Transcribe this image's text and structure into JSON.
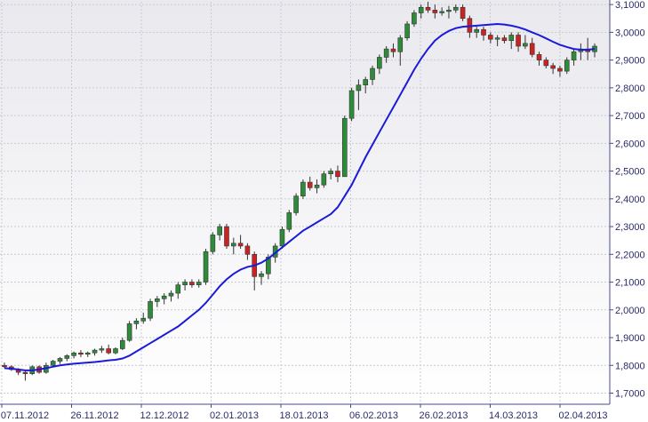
{
  "chart_data": {
    "type": "candlestick",
    "x_tick_labels": [
      "07.11.2012",
      "26.11.2012",
      "12.12.2012",
      "02.01.2013",
      "18.01.2013",
      "06.02.2013",
      "26.02.2013",
      "14.03.2013",
      "02.04.2013"
    ],
    "y_ticks": [
      1.7,
      1.8,
      1.9,
      2.0,
      2.1,
      2.2,
      2.3,
      2.4,
      2.5,
      2.6,
      2.7,
      2.8,
      2.9,
      3.0,
      3.1
    ],
    "y_tick_labels": [
      "1,7000",
      "1,8000",
      "1,9000",
      "2,0000",
      "2,1000",
      "2,2000",
      "2,3000",
      "2,4000",
      "2,5000",
      "2,6000",
      "2,7000",
      "2,8000",
      "2,9000",
      "3,0000",
      "3,1000"
    ],
    "ylim": [
      1.66,
      3.11
    ],
    "grid": true,
    "up_color": "#2e8b3a",
    "down_color": "#cc2222",
    "ma_color": "#1a1adb",
    "candles": [
      [
        1.8,
        1.81,
        1.79,
        1.795
      ],
      [
        1.795,
        1.8,
        1.78,
        1.785
      ],
      [
        1.785,
        1.79,
        1.765,
        1.775
      ],
      [
        1.775,
        1.78,
        1.745,
        1.77
      ],
      [
        1.77,
        1.8,
        1.765,
        1.795
      ],
      [
        1.795,
        1.8,
        1.77,
        1.775
      ],
      [
        1.775,
        1.81,
        1.77,
        1.8
      ],
      [
        1.8,
        1.82,
        1.795,
        1.815
      ],
      [
        1.815,
        1.83,
        1.805,
        1.825
      ],
      [
        1.825,
        1.84,
        1.815,
        1.835
      ],
      [
        1.835,
        1.85,
        1.825,
        1.845
      ],
      [
        1.845,
        1.855,
        1.83,
        1.84
      ],
      [
        1.84,
        1.85,
        1.83,
        1.845
      ],
      [
        1.845,
        1.86,
        1.835,
        1.855
      ],
      [
        1.855,
        1.87,
        1.845,
        1.86
      ],
      [
        1.86,
        1.875,
        1.84,
        1.845
      ],
      [
        1.845,
        1.865,
        1.84,
        1.86
      ],
      [
        1.86,
        1.9,
        1.855,
        1.89
      ],
      [
        1.89,
        1.96,
        1.885,
        1.95
      ],
      [
        1.95,
        1.97,
        1.93,
        1.96
      ],
      [
        1.96,
        1.99,
        1.95,
        1.97
      ],
      [
        1.97,
        2.04,
        1.96,
        2.03
      ],
      [
        2.03,
        2.05,
        2.01,
        2.04
      ],
      [
        2.04,
        2.06,
        2.02,
        2.05
      ],
      [
        2.05,
        2.07,
        2.03,
        2.06
      ],
      [
        2.06,
        2.1,
        2.04,
        2.09
      ],
      [
        2.09,
        2.11,
        2.07,
        2.1
      ],
      [
        2.1,
        2.11,
        2.08,
        2.09
      ],
      [
        2.09,
        2.11,
        2.08,
        2.1
      ],
      [
        2.1,
        2.22,
        2.09,
        2.21
      ],
      [
        2.21,
        2.28,
        2.2,
        2.27
      ],
      [
        2.27,
        2.31,
        2.25,
        2.3
      ],
      [
        2.3,
        2.31,
        2.22,
        2.23
      ],
      [
        2.23,
        2.26,
        2.2,
        2.24
      ],
      [
        2.24,
        2.27,
        2.22,
        2.23
      ],
      [
        2.23,
        2.24,
        2.18,
        2.2
      ],
      [
        2.2,
        2.21,
        2.07,
        2.12
      ],
      [
        2.12,
        2.14,
        2.09,
        2.13
      ],
      [
        2.13,
        2.2,
        2.11,
        2.19
      ],
      [
        2.19,
        2.24,
        2.17,
        2.23
      ],
      [
        2.23,
        2.3,
        2.22,
        2.29
      ],
      [
        2.29,
        2.36,
        2.28,
        2.35
      ],
      [
        2.35,
        2.42,
        2.34,
        2.41
      ],
      [
        2.41,
        2.47,
        2.4,
        2.46
      ],
      [
        2.46,
        2.48,
        2.43,
        2.44
      ],
      [
        2.44,
        2.47,
        2.42,
        2.45
      ],
      [
        2.45,
        2.5,
        2.44,
        2.49
      ],
      [
        2.49,
        2.51,
        2.47,
        2.5
      ],
      [
        2.5,
        2.52,
        2.46,
        2.48
      ],
      [
        2.48,
        2.7,
        2.48,
        2.69
      ],
      [
        2.69,
        2.8,
        2.68,
        2.79
      ],
      [
        2.79,
        2.83,
        2.72,
        2.81
      ],
      [
        2.81,
        2.84,
        2.78,
        2.83
      ],
      [
        2.83,
        2.88,
        2.81,
        2.87
      ],
      [
        2.87,
        2.92,
        2.85,
        2.91
      ],
      [
        2.91,
        2.95,
        2.89,
        2.94
      ],
      [
        2.94,
        2.96,
        2.91,
        2.93
      ],
      [
        2.93,
        2.99,
        2.88,
        2.98
      ],
      [
        2.98,
        3.04,
        2.97,
        3.03
      ],
      [
        3.03,
        3.08,
        3.02,
        3.07
      ],
      [
        3.07,
        3.1,
        3.05,
        3.09
      ],
      [
        3.09,
        3.11,
        3.07,
        3.08
      ],
      [
        3.08,
        3.1,
        3.05,
        3.07
      ],
      [
        3.07,
        3.09,
        3.06,
        3.075
      ],
      [
        3.075,
        3.095,
        3.05,
        3.08
      ],
      [
        3.08,
        3.1,
        3.07,
        3.09
      ],
      [
        3.09,
        3.1,
        3.04,
        3.05
      ],
      [
        3.05,
        3.06,
        2.98,
        3.0
      ],
      [
        3.0,
        3.02,
        2.98,
        3.01
      ],
      [
        3.01,
        3.02,
        2.97,
        2.99
      ],
      [
        2.99,
        3.0,
        2.96,
        2.975
      ],
      [
        2.975,
        2.99,
        2.95,
        2.98
      ],
      [
        2.98,
        2.99,
        2.96,
        2.97
      ],
      [
        2.97,
        3.0,
        2.94,
        2.99
      ],
      [
        2.99,
        3.0,
        2.93,
        2.95
      ],
      [
        2.95,
        2.99,
        2.94,
        2.96
      ],
      [
        2.96,
        2.98,
        2.91,
        2.92
      ],
      [
        2.92,
        2.93,
        2.88,
        2.9
      ],
      [
        2.9,
        2.91,
        2.87,
        2.88
      ],
      [
        2.88,
        2.89,
        2.85,
        2.87
      ],
      [
        2.87,
        2.88,
        2.84,
        2.86
      ],
      [
        2.86,
        2.91,
        2.85,
        2.9
      ],
      [
        2.9,
        2.94,
        2.88,
        2.93
      ],
      [
        2.93,
        2.96,
        2.9,
        2.94
      ],
      [
        2.94,
        2.98,
        2.9,
        2.93
      ],
      [
        2.93,
        2.96,
        2.91,
        2.95
      ]
    ],
    "moving_average": [
      1.79,
      1.788,
      1.785,
      1.782,
      1.782,
      1.785,
      1.79,
      1.795,
      1.8,
      1.803,
      1.806,
      1.808,
      1.81,
      1.812,
      1.815,
      1.818,
      1.82,
      1.825,
      1.835,
      1.85,
      1.865,
      1.88,
      1.895,
      1.91,
      1.925,
      1.94,
      1.96,
      1.98,
      2.0,
      2.025,
      2.055,
      2.085,
      2.11,
      2.13,
      2.145,
      2.155,
      2.16,
      2.17,
      2.185,
      2.205,
      2.225,
      2.245,
      2.265,
      2.285,
      2.3,
      2.315,
      2.33,
      2.345,
      2.37,
      2.41,
      2.45,
      2.5,
      2.55,
      2.595,
      2.64,
      2.685,
      2.73,
      2.775,
      2.82,
      2.865,
      2.905,
      2.94,
      2.97,
      2.99,
      3.005,
      3.015,
      3.02,
      3.022,
      3.024,
      3.026,
      3.028,
      3.03,
      3.028,
      3.024,
      3.018,
      3.01,
      3.0,
      2.99,
      2.978,
      2.966,
      2.955,
      2.947,
      2.94,
      2.937,
      2.937,
      2.94
    ]
  }
}
